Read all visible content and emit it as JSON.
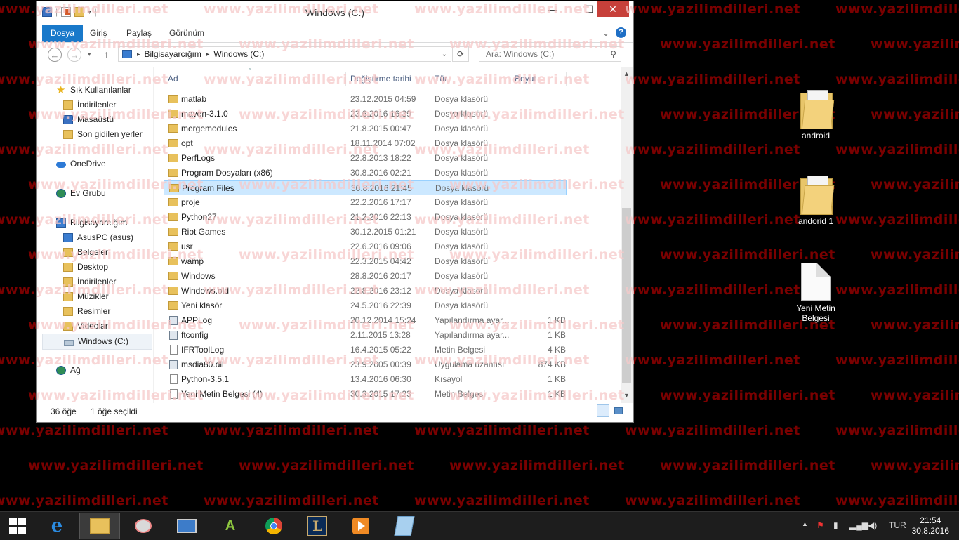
{
  "watermark": "www.yazilimdilleri.net",
  "desktop": {
    "icons": [
      {
        "label": "android",
        "type": "folder"
      },
      {
        "label": "andorid 1",
        "type": "folder"
      },
      {
        "label": "Yeni Metin Belgesi",
        "type": "text-document"
      }
    ]
  },
  "window": {
    "title": "Windows (C:)",
    "controls": {
      "minimize": "—",
      "maximize": "☐",
      "close": "✕"
    },
    "ribbon_tabs": [
      "Dosya",
      "Giriş",
      "Paylaş",
      "Görünüm"
    ],
    "help": "?",
    "address": {
      "crumbs": [
        "Bilgisayarcığım",
        "Windows (C:)"
      ]
    },
    "search_placeholder": "Ara: Windows (C:)",
    "nav_pane": [
      {
        "label": "Sık Kullanılanlar",
        "icon": "star-icon"
      },
      {
        "label": "İndirilenler",
        "icon": "downloads-folder-icon"
      },
      {
        "label": "Masaüstü",
        "icon": "desktop-icon"
      },
      {
        "label": "Son gidilen yerler",
        "icon": "recent-places-icon"
      },
      {
        "label": "OneDrive",
        "icon": "cloud-icon"
      },
      {
        "label": "Ev Grubu",
        "icon": "homegroup-icon"
      },
      {
        "label": "Bilgisayarcığım",
        "icon": "computer-icon"
      },
      {
        "label": "AsusPC (asus)",
        "icon": "network-pc-icon"
      },
      {
        "label": "Belgeler",
        "icon": "documents-folder-icon"
      },
      {
        "label": "Desktop",
        "icon": "desktop-folder-icon"
      },
      {
        "label": "İndirilenler",
        "icon": "downloads-folder-icon"
      },
      {
        "label": "Müzikler",
        "icon": "music-folder-icon"
      },
      {
        "label": "Resimler",
        "icon": "pictures-folder-icon"
      },
      {
        "label": "Videolar",
        "icon": "videos-folder-icon"
      },
      {
        "label": "Windows (C:)",
        "icon": "drive-icon"
      },
      {
        "label": "Ağ",
        "icon": "network-icon"
      }
    ],
    "columns": {
      "name": "Ad",
      "date": "Değiştirme tarihi",
      "type": "Tür",
      "size": "Boyut"
    },
    "files": [
      {
        "name": "matlab",
        "date": "23.12.2015 04:59",
        "type": "Dosya klasörü",
        "size": "",
        "icon": "folder"
      },
      {
        "name": "maven-3.1.0",
        "date": "23.6.2016 16:39",
        "type": "Dosya klasörü",
        "size": "",
        "icon": "folder"
      },
      {
        "name": "mergemodules",
        "date": "21.8.2015 00:47",
        "type": "Dosya klasörü",
        "size": "",
        "icon": "folder"
      },
      {
        "name": "opt",
        "date": "18.11.2014 07:02",
        "type": "Dosya klasörü",
        "size": "",
        "icon": "folder"
      },
      {
        "name": "PerfLogs",
        "date": "22.8.2013 18:22",
        "type": "Dosya klasörü",
        "size": "",
        "icon": "folder"
      },
      {
        "name": "Program Dosyaları (x86)",
        "date": "30.8.2016 02:21",
        "type": "Dosya klasörü",
        "size": "",
        "icon": "folder"
      },
      {
        "name": "Program Files",
        "date": "30.8.2016 21:45",
        "type": "Dosya klasörü",
        "size": "",
        "icon": "folder",
        "selected": true
      },
      {
        "name": "proje",
        "date": "22.2.2016 17:17",
        "type": "Dosya klasörü",
        "size": "",
        "icon": "folder"
      },
      {
        "name": "Python27",
        "date": "21.2.2016 22:13",
        "type": "Dosya klasörü",
        "size": "",
        "icon": "folder"
      },
      {
        "name": "Riot Games",
        "date": "30.12.2015 01:21",
        "type": "Dosya klasörü",
        "size": "",
        "icon": "folder"
      },
      {
        "name": "usr",
        "date": "22.6.2016 09:06",
        "type": "Dosya klasörü",
        "size": "",
        "icon": "folder"
      },
      {
        "name": "wamp",
        "date": "22.3.2015 04:42",
        "type": "Dosya klasörü",
        "size": "",
        "icon": "folder"
      },
      {
        "name": "Windows",
        "date": "28.8.2016 20:17",
        "type": "Dosya klasörü",
        "size": "",
        "icon": "folder"
      },
      {
        "name": "Windows.old",
        "date": "22.8.2016 23:12",
        "type": "Dosya klasörü",
        "size": "",
        "icon": "folder"
      },
      {
        "name": "Yeni klasör",
        "date": "24.5.2016 22:39",
        "type": "Dosya klasörü",
        "size": "",
        "icon": "folder"
      },
      {
        "name": "APPLog",
        "date": "20.12.2014 15:24",
        "type": "Yapılandırma ayar...",
        "size": "1 KB",
        "icon": "config"
      },
      {
        "name": "ftconfig",
        "date": "2.11.2015 13:28",
        "type": "Yapılandırma ayar...",
        "size": "1 KB",
        "icon": "config"
      },
      {
        "name": "IFRToolLog",
        "date": "16.4.2015 05:22",
        "type": "Metin Belgesi",
        "size": "4 KB",
        "icon": "text"
      },
      {
        "name": "msdia80.dll",
        "date": "23.9.2005 00:39",
        "type": "Uygulama uzantısı",
        "size": "874 KB",
        "icon": "config"
      },
      {
        "name": "Python-3.5.1",
        "date": "13.4.2016 06:30",
        "type": "Kısayol",
        "size": "1 KB",
        "icon": "shortcut"
      },
      {
        "name": "Yeni Metin Belgesi (4)",
        "date": "30.3.2015 17:23",
        "type": "Metin Belgesi",
        "size": "1 KB",
        "icon": "text"
      }
    ],
    "status": {
      "item_count": "36 öğe",
      "selection": "1 öğe seçildi"
    }
  },
  "taskbar": {
    "apps": [
      "start",
      "internet-explorer",
      "file-explorer",
      "paint",
      "remote-desktop",
      "android-studio",
      "chrome",
      "league-of-legends",
      "media-player",
      "notepad"
    ],
    "language": "TUR",
    "time": "21:54",
    "date": "30.8.2016"
  },
  "colors": {
    "accent": "#1979ca",
    "selection": "#cce8ff",
    "close": "#c7403a",
    "watermark": "#7a0000"
  }
}
